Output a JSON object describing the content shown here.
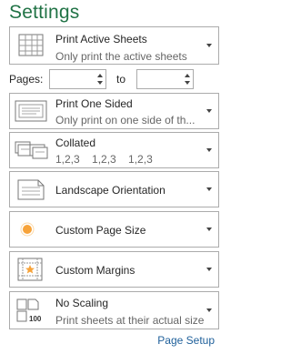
{
  "title": "Settings",
  "print_what": {
    "label": "Print Active Sheets",
    "desc": "Only print the active sheets",
    "icon": "sheets-grid-icon"
  },
  "pages": {
    "label": "Pages:",
    "from_value": "",
    "to_label": "to",
    "to_value": ""
  },
  "sides": {
    "label": "Print One Sided",
    "desc": "Only print on one side of th...",
    "icon": "one-sided-page-icon"
  },
  "collation": {
    "label": "Collated",
    "desc": "1,2,3    1,2,3    1,2,3",
    "icon": "collated-pages-icon"
  },
  "orientation": {
    "label": "Landscape Orientation",
    "icon": "landscape-page-icon"
  },
  "page_size": {
    "label": "Custom Page Size",
    "icon": "page-size-dot-icon"
  },
  "margins": {
    "label": "Custom Margins",
    "icon": "margins-star-icon"
  },
  "scaling": {
    "label": "No Scaling",
    "desc": "Print sheets at their actual size",
    "icon": "scaling-100-icon",
    "icon_text": "100"
  },
  "page_setup_link": "Page Setup",
  "colors": {
    "title": "#217346",
    "link": "#1e5f9a",
    "accent_orange": "#f7a33a"
  }
}
